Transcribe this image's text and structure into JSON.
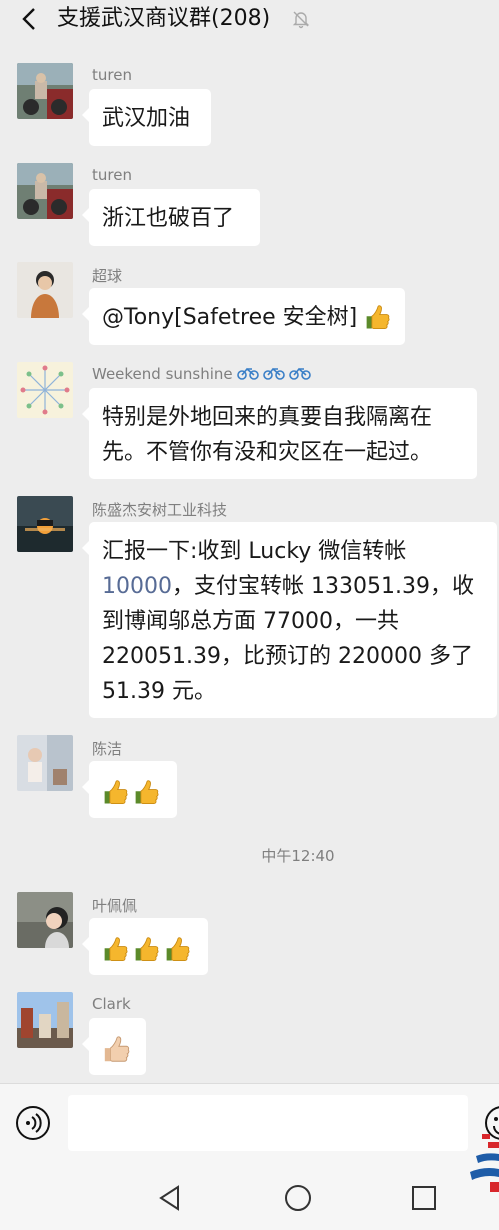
{
  "header": {
    "title": "支援武汉商议群(208)",
    "back_icon": "back-arrow-icon",
    "mute_icon": "bell-muted-icon"
  },
  "messages": [
    {
      "sender": "turen",
      "text": "武汉加油"
    },
    {
      "sender": "turen",
      "text": "浙江也破百了"
    },
    {
      "sender": "超球",
      "text": "@Tony[Safetree 安全树]",
      "emoji": "thumbs-up"
    },
    {
      "sender": "Weekend sunshine",
      "sender_emoji": "bicycle x3",
      "lines": [
        "特别是外地回来的真要自我隔离在",
        "先。不管你有没和灾区在一起过。"
      ]
    },
    {
      "sender": "陈盛杰安树工业科技",
      "lines": {
        "l1": "汇报一下:收到 Lucky 微信转帐",
        "l2_link": "10000",
        "l2_rest": "，支付宝转帐 133051.39，收",
        "l3": "到博闻邬总方面 77000，一共",
        "l4": "220051.39，比预订的 220000 多了",
        "l5": "51.39 元。"
      }
    },
    {
      "sender": "陈洁",
      "emoji": "thumbs-up x2"
    }
  ],
  "timestamp": "中午12:40",
  "messages_after": [
    {
      "sender": "叶佩佩",
      "emoji": "thumbs-up x3"
    },
    {
      "sender": "Clark",
      "emoji": "thumbs-up light skin"
    }
  ],
  "input_bar": {
    "voice_icon": "voice-icon",
    "emoji_icon": "emoji-icon",
    "text": ""
  },
  "nav_bar": {
    "icons": [
      "nav-back-icon",
      "nav-home-icon",
      "nav-recent-icon"
    ]
  },
  "colors": {
    "background": "#ededed",
    "bubble": "#ffffff",
    "link": "#576b95",
    "meta_text": "#7f7f7f"
  }
}
